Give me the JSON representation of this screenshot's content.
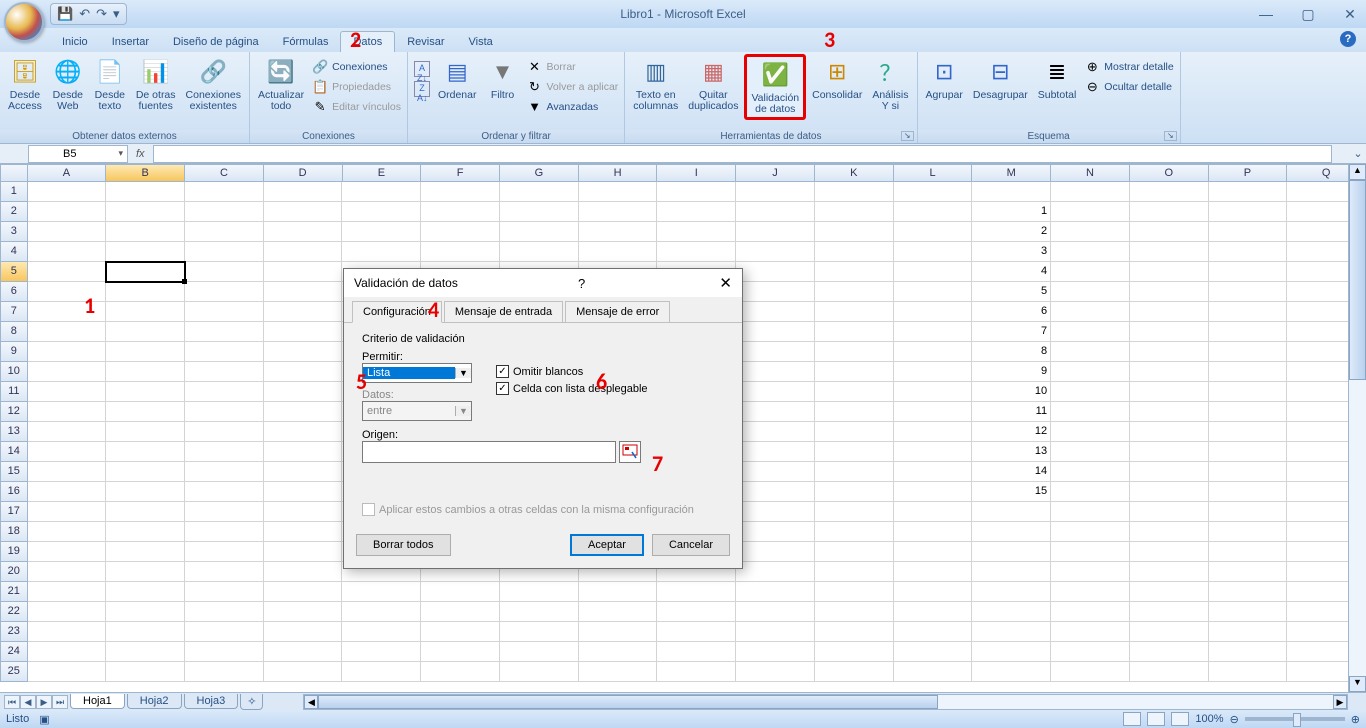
{
  "title": "Libro1 - Microsoft Excel",
  "qat": {
    "save": "💾",
    "undo": "↶",
    "redo": "↷",
    "more": "▾"
  },
  "tabs": {
    "inicio": "Inicio",
    "insertar": "Insertar",
    "diseno": "Diseño de página",
    "formulas": "Fórmulas",
    "datos": "Datos",
    "revisar": "Revisar",
    "vista": "Vista"
  },
  "ribbon": {
    "ext": {
      "label": "Obtener datos externos",
      "access": "Desde\nAccess",
      "web": "Desde\nWeb",
      "texto": "Desde\ntexto",
      "otras": "De otras\nfuentes",
      "exist": "Conexiones\nexistentes"
    },
    "conex": {
      "label": "Conexiones",
      "refresh": "Actualizar\ntodo",
      "con": "Conexiones",
      "prop": "Propiedades",
      "edit": "Editar vínculos"
    },
    "sort": {
      "label": "Ordenar y filtrar",
      "az": "A↓Z",
      "za": "Z↓A",
      "ordenar": "Ordenar",
      "filtro": "Filtro",
      "borrar": "Borrar",
      "volver": "Volver a aplicar",
      "avanz": "Avanzadas"
    },
    "tools": {
      "label": "Herramientas de datos",
      "tcol": "Texto en\ncolumnas",
      "dup": "Quitar\nduplicados",
      "valid": "Validación\nde datos",
      "cons": "Consolidar",
      "what": "Análisis\nY si"
    },
    "esq": {
      "label": "Esquema",
      "grp": "Agrupar",
      "ungrp": "Desagrupar",
      "sub": "Subtotal",
      "mostrar": "Mostrar detalle",
      "ocultar": "Ocultar detalle"
    }
  },
  "namebox": "B5",
  "columns": [
    "A",
    "B",
    "C",
    "D",
    "E",
    "F",
    "G",
    "H",
    "I",
    "J",
    "K",
    "L",
    "M",
    "N",
    "O",
    "P",
    "Q"
  ],
  "rowcount": 25,
  "cellvalues": {
    "M2": "1",
    "M3": "2",
    "M4": "3",
    "M5": "4",
    "M6": "5",
    "M7": "6",
    "M8": "7",
    "M9": "8",
    "M10": "9",
    "M11": "10",
    "M12": "11",
    "M13": "12",
    "M14": "13",
    "M15": "14",
    "M16": "15"
  },
  "sheets": {
    "nav": [
      "⏮",
      "◀",
      "▶",
      "⏭"
    ],
    "h1": "Hoja1",
    "h2": "Hoja2",
    "h3": "Hoja3"
  },
  "status": {
    "ready": "Listo",
    "zoom": "100%"
  },
  "dialog": {
    "title": "Validación de datos",
    "tab1": "Configuración",
    "tab2": "Mensaje de entrada",
    "tab3": "Mensaje de error",
    "criterio": "Criterio de validación",
    "permitir": "Permitir:",
    "permitirval": "Lista",
    "datos": "Datos:",
    "datosval": "entre",
    "omitir": "Omitir blancos",
    "celda": "Celda con lista desplegable",
    "origen": "Origen:",
    "aplicar": "Aplicar estos cambios a otras celdas con la misma configuración",
    "borrar": "Borrar todos",
    "aceptar": "Aceptar",
    "cancelar": "Cancelar"
  },
  "ann": {
    "a1": "1",
    "a2": "2",
    "a3": "3",
    "a4": "4",
    "a5": "5",
    "a6": "6",
    "a7": "7"
  }
}
